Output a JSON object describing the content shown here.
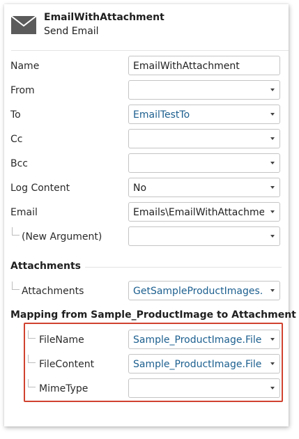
{
  "header": {
    "title": "EmailWithAttachment",
    "subtitle": "Send Email",
    "icon": "envelope-icon"
  },
  "properties": [
    {
      "label": "Name",
      "value": "EmailWithAttachment",
      "kind": "input",
      "link": false
    },
    {
      "label": "From",
      "value": "",
      "kind": "select",
      "link": false
    },
    {
      "label": "To",
      "value": "EmailTestTo",
      "kind": "select",
      "link": true
    },
    {
      "label": "Cc",
      "value": "",
      "kind": "select",
      "link": false
    },
    {
      "label": "Bcc",
      "value": "",
      "kind": "select",
      "link": false
    },
    {
      "label": "Log Content",
      "value": "No",
      "kind": "select",
      "link": false
    },
    {
      "label": "Email",
      "value": "Emails\\EmailWithAttachme",
      "kind": "select",
      "link": false
    },
    {
      "label": "(New Argument)",
      "value": "",
      "kind": "select",
      "link": false
    }
  ],
  "attachments": {
    "title": "Attachments",
    "label": "Attachments",
    "value": "GetSampleProductImages."
  },
  "mapping": {
    "title": "Mapping from Sample_ProductImage to Attachment",
    "rows": [
      {
        "label": "FileName",
        "value": "Sample_ProductImage.File"
      },
      {
        "label": "FileContent",
        "value": "Sample_ProductImage.File"
      },
      {
        "label": "MimeType",
        "value": ""
      }
    ]
  },
  "colors": {
    "link": "#1c5f8f",
    "highlight": "#d0422f",
    "icon": "#5b5b5b"
  }
}
